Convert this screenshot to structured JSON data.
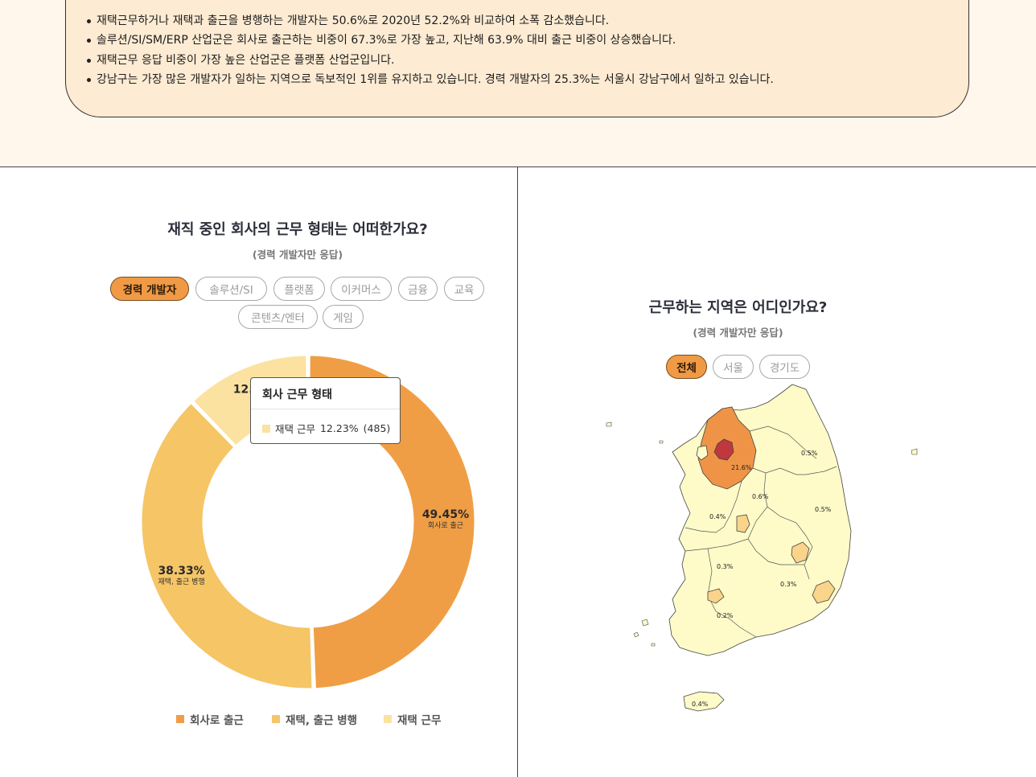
{
  "summary": {
    "bullets": [
      "재택근무하거나 재택과 출근을 병행하는 개발자는 50.6%로 2020년 52.2%와 비교하여 소폭 감소했습니다.",
      "솔루션/SI/SM/ERP 산업군은 회사로 출근하는 비중이 67.3%로 가장 높고, 지난해 63.9% 대비 출근 비중이 상승했습니다.",
      "재택근무 응답 비중이 가장 높은 산업군은 플랫폼 산업군입니다.",
      "강남구는 가장 많은 개발자가 일하는 지역으로 독보적인 1위를 유지하고 있습니다. 경력 개발자의 25.3%는 서울시 강남구에서 일하고 있습니다."
    ]
  },
  "left_panel": {
    "title": "재직 중인 회사의 근무 형태는 어떠한가요?",
    "subtitle": "(경력 개발자만 응답)",
    "filters": [
      "경력 개발자",
      "솔루션/SI",
      "플랫폼",
      "이커머스",
      "금융",
      "교육",
      "콘텐츠/엔터",
      "게임"
    ],
    "active_filter": "경력 개발자"
  },
  "tooltip": {
    "title": "회사 근무 형태",
    "label": "재택 근무",
    "percent": "12.23%",
    "count": "(485)"
  },
  "right_panel": {
    "title": "근무하는 지역은 어디인가요?",
    "subtitle": "(경력 개발자만 응답)",
    "filters": [
      "전체",
      "서울",
      "경기도"
    ],
    "active_filter": "전체"
  },
  "colors": {
    "office": "#f09e45",
    "hybrid": "#f5c566",
    "remote": "#fbe2a0",
    "active_chip": "#f09a45",
    "map_base": "#fefbc8",
    "map_mid": "#f9d48a",
    "map_high": "#ef9447",
    "map_top": "#c0373e"
  },
  "chart_data": [
    {
      "type": "pie",
      "title": "재직 중인 회사의 근무 형태는 어떠한가요?",
      "subtitle": "(경력 개발자만 응답)",
      "categories": [
        "회사로 출근",
        "재택, 출근 병행",
        "재택 근무"
      ],
      "values": [
        49.45,
        38.33,
        12.23
      ],
      "labels": [
        "49.45%",
        "38.33%",
        "12.23%"
      ],
      "slice_labels": [
        "회사로 출근",
        "재택, 출근 병행",
        "재택"
      ],
      "legend": [
        "회사로 출근",
        "재택, 출근 병행",
        "재택 근무"
      ],
      "legend_position": "bottom"
    },
    {
      "type": "heatmap",
      "title": "근무하는 지역은 어디인가요?",
      "subtitle": "(경력 개발자만 응답)",
      "map_labels": [
        "21.6%",
        "0.5%",
        "0.6%",
        "0.5%",
        "0.4%",
        "0.3%",
        "0.3%",
        "0.2%",
        "0.4%"
      ]
    }
  ]
}
